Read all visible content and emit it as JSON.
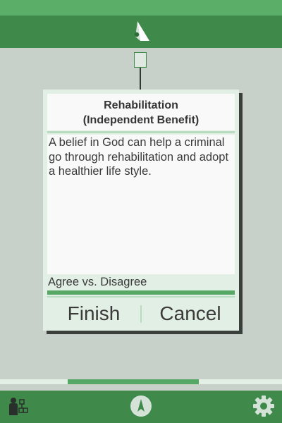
{
  "card": {
    "title_line1": "Rehabilitation",
    "title_line2": "(Independent Benefit)",
    "body": "A belief in God can help a criminal go through rehabilitation and adopt a healthier life style.",
    "scale_label": "Agree vs. Disagree",
    "finish_label": "Finish",
    "cancel_label": "Cancel"
  },
  "progress": {
    "start": 0.24,
    "end": 0.705
  },
  "colors": {
    "header": "#3f8a4a",
    "status_bar": "#5aae68",
    "accent": "#55a865",
    "card_bg": "#e1efe4",
    "page_bg": "#c8d0ca"
  },
  "icons": {
    "header": "argument-logo-icon",
    "footer_left": "user-map-icon",
    "footer_center": "compass-icon",
    "footer_right": "gear-icon"
  }
}
